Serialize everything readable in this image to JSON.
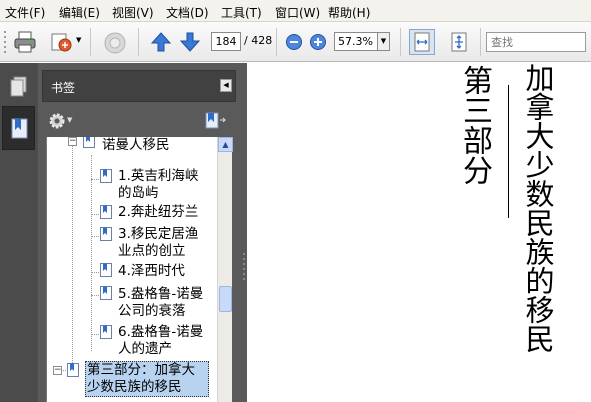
{
  "menubar": {
    "items": [
      "文件(F)",
      "编辑(E)",
      "视图(V)",
      "文档(D)",
      "工具(T)",
      "窗口(W)",
      "帮助(H)"
    ]
  },
  "toolbar": {
    "page_current": "184",
    "page_total": "/ 428",
    "zoom_value": "57.3%",
    "search_placeholder": "查找"
  },
  "panel": {
    "title": "书签"
  },
  "bookmarks": {
    "chapter4": "第四章：盎格鲁-诺曼人移民",
    "chapter4_visible_line2": "诺曼人移民",
    "items": [
      "1.英吉利海峡的岛屿",
      "2.奔赴纽芬兰",
      "3.移民定居渔业点的创立",
      "4.泽西时代",
      "5.盎格鲁-诺曼公司的衰落",
      "6.盎格鲁-诺曼人的遗产"
    ],
    "items_lines": [
      [
        "1.英吉利海峡",
        "的岛屿"
      ],
      [
        "2.奔赴纽芬兰"
      ],
      [
        "3.移民定居渔",
        "业点的创立"
      ],
      [
        "4.泽西时代"
      ],
      [
        "5.盎格鲁-诺曼",
        "公司的衰落"
      ],
      [
        "6.盎格鲁-诺曼",
        "人的遗产"
      ]
    ],
    "part3_lines": [
      "第三部分：加拿大",
      "少数民族的移民"
    ],
    "part3": "第三部分：加拿大少数民族的移民"
  },
  "document": {
    "part_label": "第三部分",
    "title": "加拿大少数民族的移民"
  },
  "colors": {
    "panel_bg": "#5a5a5a",
    "selection": "#b7d3f0",
    "nav_blue": "#2f6cc9"
  }
}
